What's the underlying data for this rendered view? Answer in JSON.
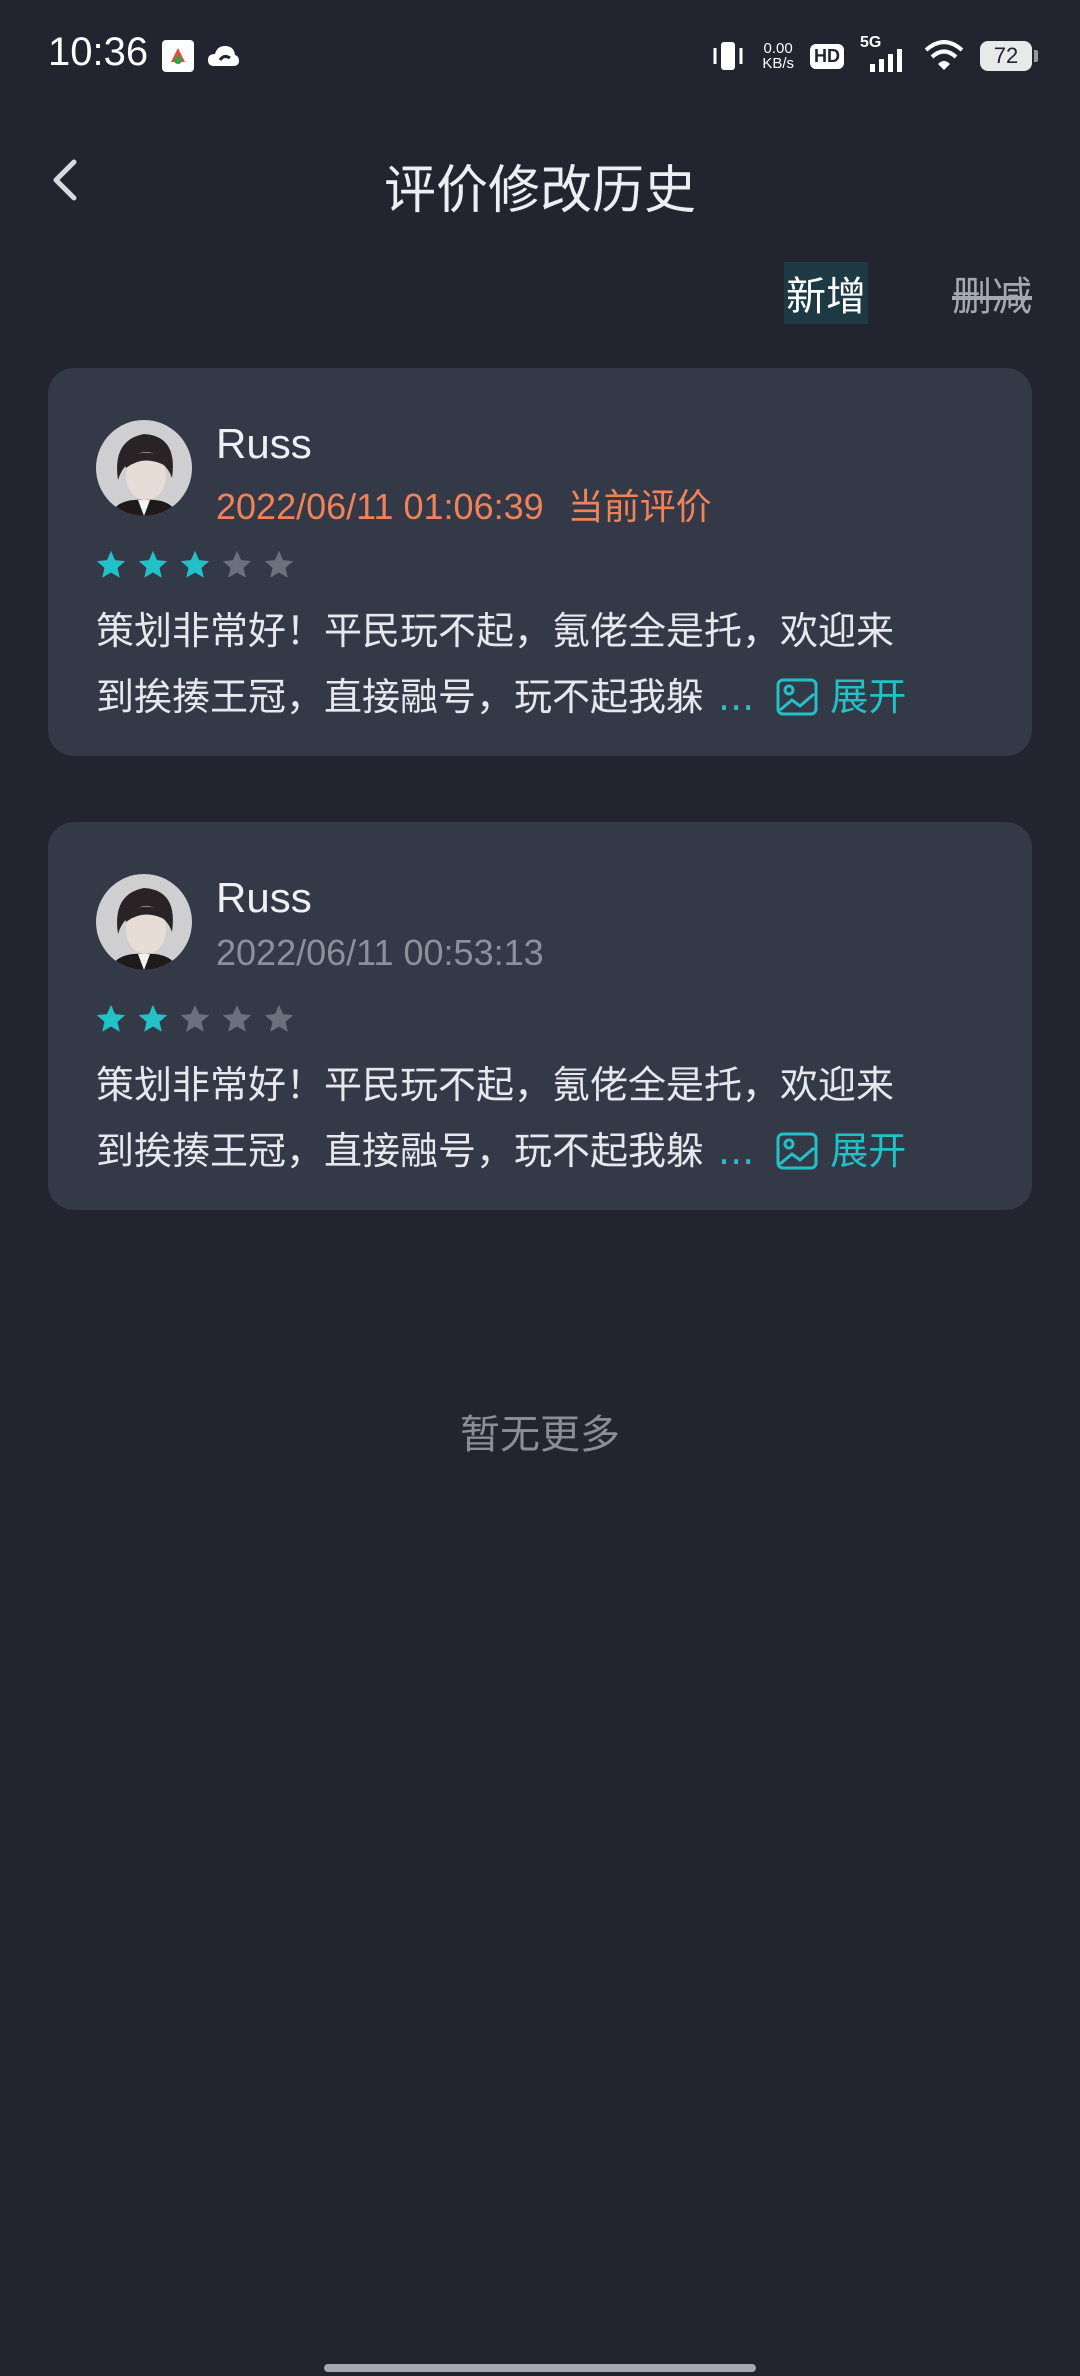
{
  "status_bar": {
    "time": "10:36",
    "net_speed_value": "0.00",
    "net_speed_unit": "KB/s",
    "hd": "HD",
    "network": "5G",
    "battery": "72"
  },
  "header": {
    "title": "评价修改历史"
  },
  "filter": {
    "add_label": "新增",
    "delete_label": "删减"
  },
  "reviews": [
    {
      "user": "Russ",
      "time": "2022/06/11 01:06:39",
      "tag": "当前评价",
      "rating": 3,
      "text_line1": "策划非常好！平民玩不起，氪佬全是托，欢迎来",
      "text_line2": "到挨揍王冠，直接融号，玩不起我躲",
      "ellipsis": "...",
      "expand": "展开"
    },
    {
      "user": "Russ",
      "time": "2022/06/11 00:53:13",
      "tag": "",
      "rating": 2,
      "text_line1": "策划非常好！平民玩不起，氪佬全是托，欢迎来",
      "text_line2": "到挨揍王冠，直接融号，玩不起我躲",
      "ellipsis": "...",
      "expand": "展开"
    }
  ],
  "footer": {
    "no_more": "暂无更多"
  },
  "colors": {
    "background": "#22252f",
    "card": "#343947",
    "accent": "#22c1c7",
    "current": "#f0825a",
    "star_off": "#6b707c"
  },
  "icons": [
    "back-arrow-icon",
    "image-icon",
    "star-icon"
  ]
}
